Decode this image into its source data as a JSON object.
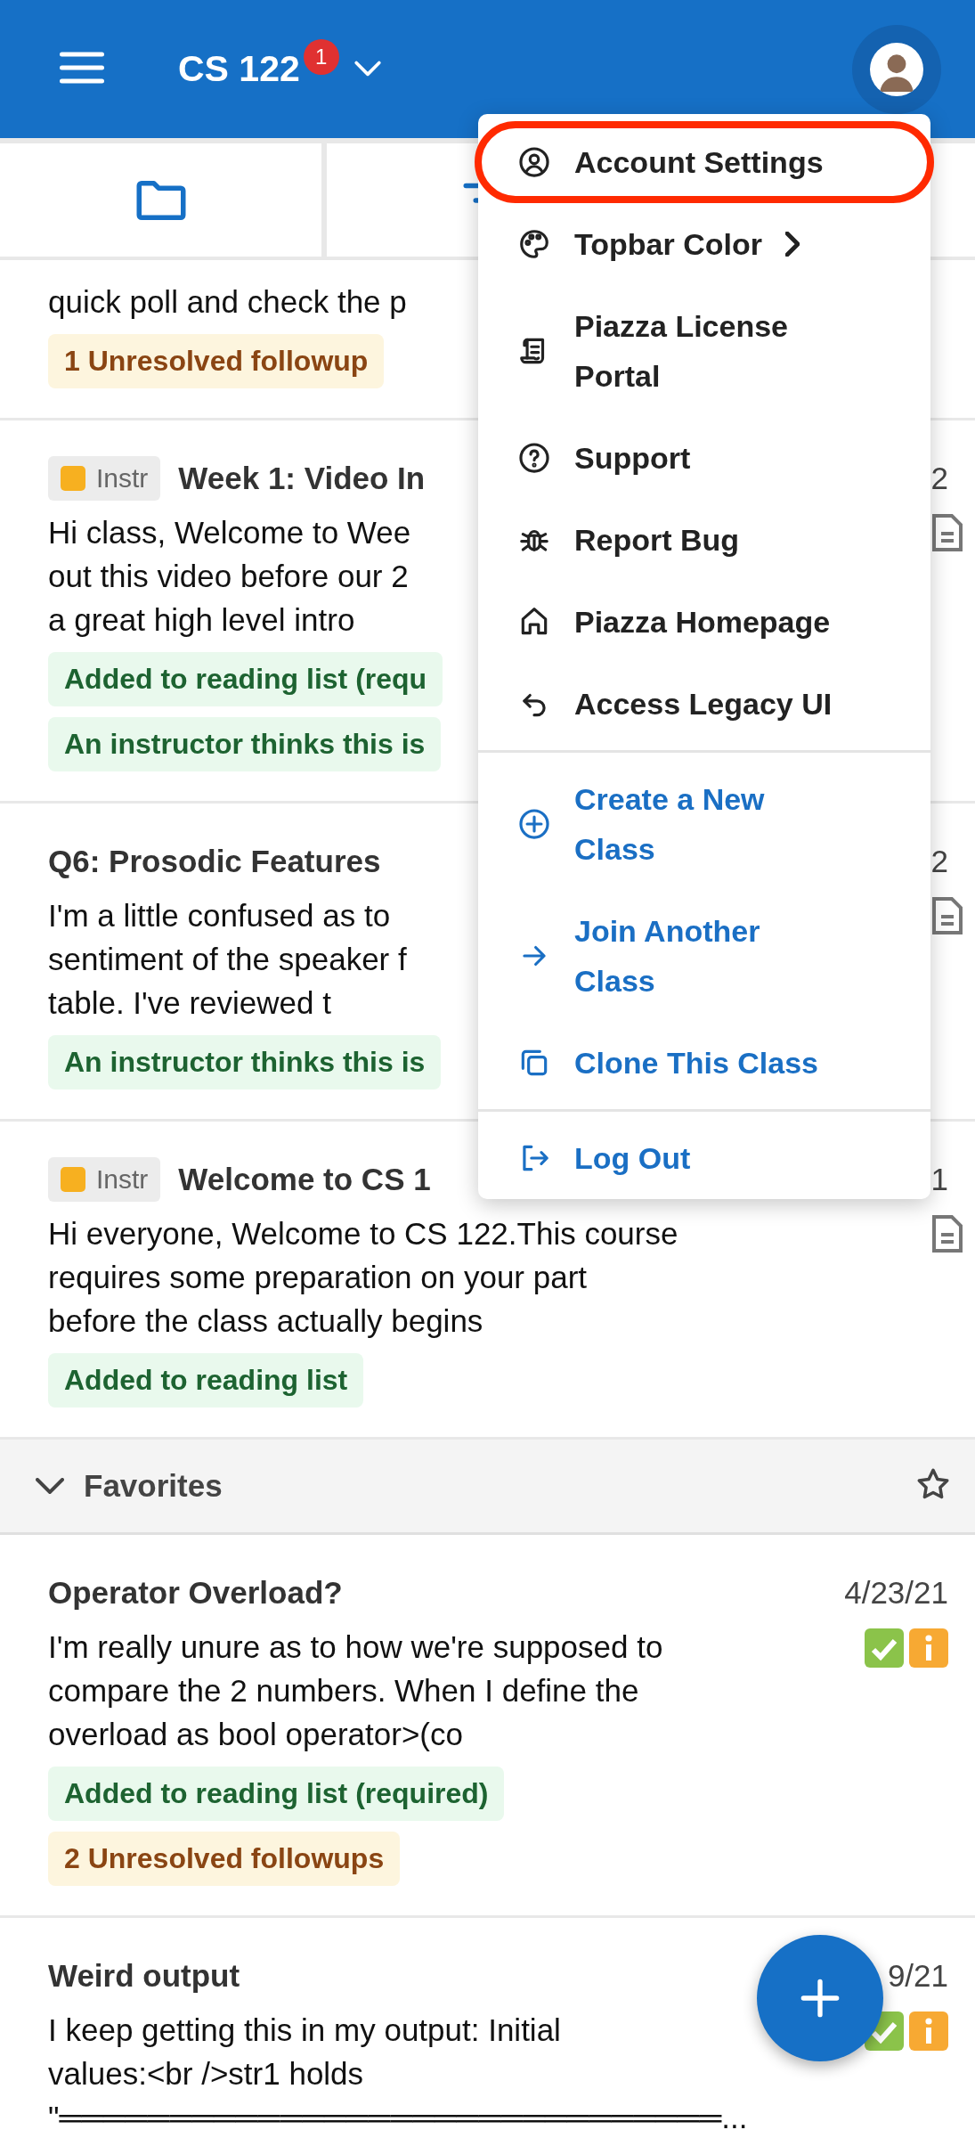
{
  "topbar": {
    "course": "CS 122",
    "notification_count": "1"
  },
  "posts": [
    {
      "lines": [
        "quick poll and check the p"
      ],
      "tags": [
        {
          "text": "1 Unresolved followup",
          "kind": "followup"
        }
      ]
    },
    {
      "kind": "note",
      "chip": "Instr",
      "title": "Week 1: Video In",
      "date": "2",
      "lines": [
        "Hi class,  Welcome to Wee",
        "out this video before our 2",
        "a great high level intro"
      ],
      "tags": [
        {
          "text": "Added to reading list (requ",
          "kind": "reading"
        },
        {
          "text": "An instructor thinks this is",
          "kind": "reading"
        }
      ]
    },
    {
      "kind": "note",
      "title": "Q6: Prosodic Features",
      "date": "2",
      "lines": [
        "I'm a little confused as to",
        "sentiment of the speaker f",
        "table.  I've reviewed t"
      ],
      "tags": [
        {
          "text": "An instructor thinks this is",
          "kind": "reading"
        }
      ]
    },
    {
      "kind": "note",
      "chip": "Instr",
      "title": "Welcome to CS 1",
      "date": "1",
      "lines": [
        "Hi everyone, Welcome to CS 122.This course",
        "requires some preparation on your part",
        "before the class actually begins"
      ],
      "tags": [
        {
          "text": "Added to reading list",
          "kind": "reading"
        }
      ]
    }
  ],
  "favorites": {
    "label": "Favorites",
    "expanded": true
  },
  "favorite_posts": [
    {
      "kind": "question",
      "title": "Operator Overload?",
      "date": "4/23/21",
      "lines": [
        "I'm really unure as to how we're supposed to",
        "compare the 2 numbers. When I define the",
        "overload as bool operator>(co"
      ],
      "tags": [
        {
          "text": "Added to reading list (required)",
          "kind": "reading"
        },
        {
          "text": "2 Unresolved followups",
          "kind": "followup"
        }
      ]
    },
    {
      "kind": "question",
      "title": "Weird output",
      "date": "9/21",
      "lines": [
        "I keep getting this in my output: Initial",
        "values:<br />str1 holds",
        "\"══════════════════════════════..."
      ]
    }
  ],
  "menu": {
    "sections": [
      {
        "items": [
          {
            "label": "Account Settings",
            "kind": "plain",
            "submenu": false,
            "highlighted": true
          },
          {
            "label": "Topbar Color",
            "kind": "plain",
            "submenu": true,
            "highlighted": false
          },
          {
            "label": "Piazza License\nPortal",
            "kind": "plain",
            "submenu": false,
            "highlighted": false
          },
          {
            "label": "Support",
            "kind": "plain",
            "submenu": false,
            "highlighted": false
          },
          {
            "label": "Report Bug",
            "kind": "plain",
            "submenu": false,
            "highlighted": false
          },
          {
            "label": "Piazza Homepage",
            "kind": "plain",
            "submenu": false,
            "highlighted": false
          },
          {
            "label": "Access Legacy UI",
            "kind": "plain",
            "submenu": false,
            "highlighted": false
          }
        ]
      },
      {
        "items": [
          {
            "label": "Create a New\nClass",
            "kind": "accent",
            "submenu": false,
            "highlighted": false
          },
          {
            "label": "Join Another\nClass",
            "kind": "accent",
            "submenu": false,
            "highlighted": false
          },
          {
            "label": "Clone This Class",
            "kind": "accent",
            "submenu": false,
            "highlighted": false
          }
        ]
      },
      {
        "items": [
          {
            "label": "Log Out",
            "kind": "accent",
            "submenu": false,
            "highlighted": false
          }
        ]
      }
    ]
  }
}
